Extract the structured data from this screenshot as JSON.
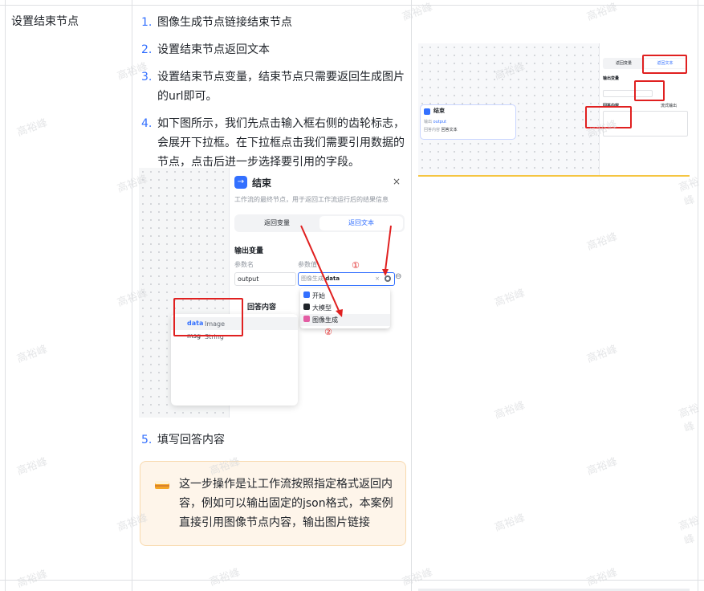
{
  "row_title": "设置结束节点",
  "steps": [
    {
      "num": "1.",
      "text": "图像生成节点链接结束节点"
    },
    {
      "num": "2.",
      "text": "设置结束节点返回文本"
    },
    {
      "num": "3.",
      "text": "设置结束节点变量，结束节点只需要返回生成图片的url即可。"
    },
    {
      "num": "4.",
      "text": "如下图所示，我们先点击输入框右侧的齿轮标志，会展开下拉框。在下拉框点击我们需要引用数据的节点，点击后进一步选择要引用的字段。"
    },
    {
      "num": "5.",
      "text": "填写回答内容"
    }
  ],
  "callout": {
    "text": "这一步操作是让工作流按照指定格式返回内容，例如可以输出固定的json格式，本案例直接引用图像节点内容，输出图片链接"
  },
  "watermark": "高裕峰",
  "screenshot_main": {
    "panel_title": "结束",
    "panel_desc": "工作流的最终节点，用于返回工作流运行后的结果信息",
    "tab_return_var": "返回变量",
    "tab_return_text": "返回文本",
    "section_output": "输出变量",
    "col_param_name": "参数名",
    "col_param_value": "参数值",
    "output_value": "output",
    "ref_prefix": "图像生成",
    "ref_value": "data",
    "section_answer": "回答内容",
    "menu_items": [
      "开始",
      "大模型",
      "图像生成"
    ],
    "fields": [
      {
        "name": "data",
        "type": "Image"
      },
      {
        "name": "msg",
        "type": "String"
      }
    ],
    "marker1": "①",
    "marker2": "②"
  },
  "screenshot_top": {
    "node_title": "结束",
    "node_row1_label": "输出",
    "node_row1_value": "output",
    "node_row2_label": "回答内容",
    "node_row2_value": "回答文本",
    "tab_return_var": "返回变量",
    "tab_return_text": "返回文本",
    "section_output": "输出变量",
    "section_answer": "回答内容",
    "stream_label": "流式输出"
  },
  "colors": {
    "accent": "#3370ff",
    "red": "#e02020",
    "callout_bg": "#fef5ea"
  }
}
